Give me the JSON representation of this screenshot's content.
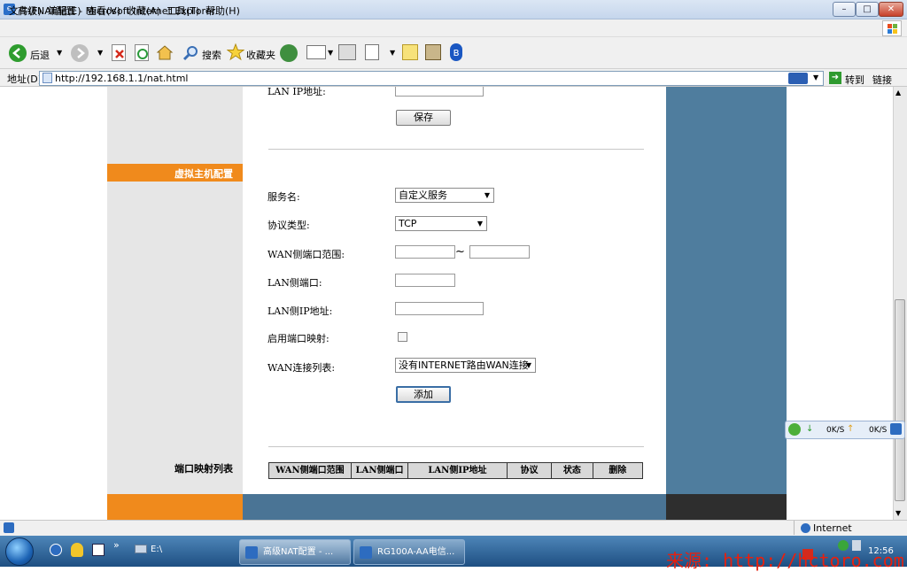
{
  "window": {
    "title": "高级NAT配置 - Microsoft Internet Explorer",
    "controls": {
      "minimize": "–",
      "maximize": "□",
      "close": "✕"
    }
  },
  "menu": [
    "文件(F)",
    "编辑(E)",
    "查看(V)",
    "收藏(A)",
    "工具(T)",
    "帮助(H)"
  ],
  "toolbar": {
    "back_label": "后退",
    "search_label": "搜索",
    "favorites_label": "收藏夹"
  },
  "address": {
    "label": "地址(D)",
    "url": "http://192.168.1.1/nat.html",
    "go_label": "转到",
    "links_label": "链接"
  },
  "page": {
    "top_field_label": "LAN IP地址:",
    "save_button": "保存",
    "section_virtual_host": "虚拟主机配置",
    "fields": {
      "service_name_label": "服务名:",
      "service_name_value": "自定义服务",
      "protocol_label": "协议类型:",
      "protocol_value": "TCP",
      "wan_port_range_label": "WAN侧端口范围:",
      "range_separator": "~",
      "lan_port_label": "LAN侧端口:",
      "lan_ip_label": "LAN侧IP地址:",
      "enable_mapping_label": "启用端口映射:",
      "wan_conn_list_label": "WAN连接列表:",
      "wan_conn_list_value": "没有INTERNET路由WAN连接"
    },
    "add_button": "添加",
    "port_list_label": "端口映射列表",
    "table_headers": [
      "WAN侧端口范围",
      "LAN侧端口",
      "LAN侧IP地址",
      "协议",
      "状态",
      "删除"
    ]
  },
  "speed_widget": {
    "down": "0K/S",
    "up": "0K/S"
  },
  "statusbar": {
    "zone": "Internet"
  },
  "taskbar": {
    "folder_label": "E:\\",
    "chevron": "»",
    "tasks": [
      "高级NAT配置 - ...",
      "RG100A-AA电信..."
    ],
    "clock": "12:56"
  },
  "watermark": "来源: http://hctoro.com"
}
